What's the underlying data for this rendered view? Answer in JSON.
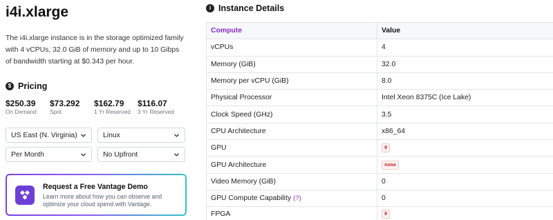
{
  "instance": {
    "name": "i4i.xlarge",
    "description": "The i4i.xlarge instance is in the storage optimized family with 4 vCPUs, 32.0 GiB of memory and up to 10 Gibps of bandwidth starting at $0.343 per hour."
  },
  "pricing": {
    "heading": "Pricing",
    "icon": "dollar-icon",
    "items": [
      {
        "value": "$250.39",
        "label": "On Demand"
      },
      {
        "value": "$73.292",
        "label": "Spot"
      },
      {
        "value": "$162.79",
        "label": "1 Yr Reserved"
      },
      {
        "value": "$116.07",
        "label": "3 Yr Reserved"
      }
    ]
  },
  "filters": {
    "region": "US East (N. Virginia)",
    "os": "Linux",
    "period": "Per Month",
    "reservation": "No Upfront"
  },
  "demo": {
    "title": "Request a Free Vantage Demo",
    "subtitle_line1": "Learn more about how you can observe and",
    "subtitle_line2": "optimize your cloud spend with Vantage.",
    "gradient_start": "#7b3fe4",
    "gradient_end": "#2ec5c9",
    "logo_color": "#6e3fd6"
  },
  "details": {
    "heading": "Instance Details",
    "icon": "info-icon",
    "columns": [
      "Compute",
      "Value"
    ],
    "rows": [
      {
        "label": "vCPUs",
        "value": "4"
      },
      {
        "label": "Memory (GiB)",
        "value": "32.0"
      },
      {
        "label": "Memory per vCPU (GiB)",
        "value": "8.0"
      },
      {
        "label": "Physical Processor",
        "value": "Intel Xeon 8375C (Ice Lake)"
      },
      {
        "label": "Clock Speed (GHz)",
        "value": "3.5"
      },
      {
        "label": "CPU Architecture",
        "value": "x86_64"
      },
      {
        "label": "GPU",
        "value": "0"
      },
      {
        "label": "GPU Architecture",
        "value": "none"
      },
      {
        "label": "Video Memory (GiB)",
        "value": "0"
      },
      {
        "label": "GPU Compute Capability",
        "help": "(?)",
        "value": "0"
      },
      {
        "label": "FPGA",
        "value": "0"
      }
    ]
  },
  "colors": {
    "accent_purple": "#8a2bd2",
    "code_red": "#c62828",
    "border": "#e1e4e8"
  }
}
